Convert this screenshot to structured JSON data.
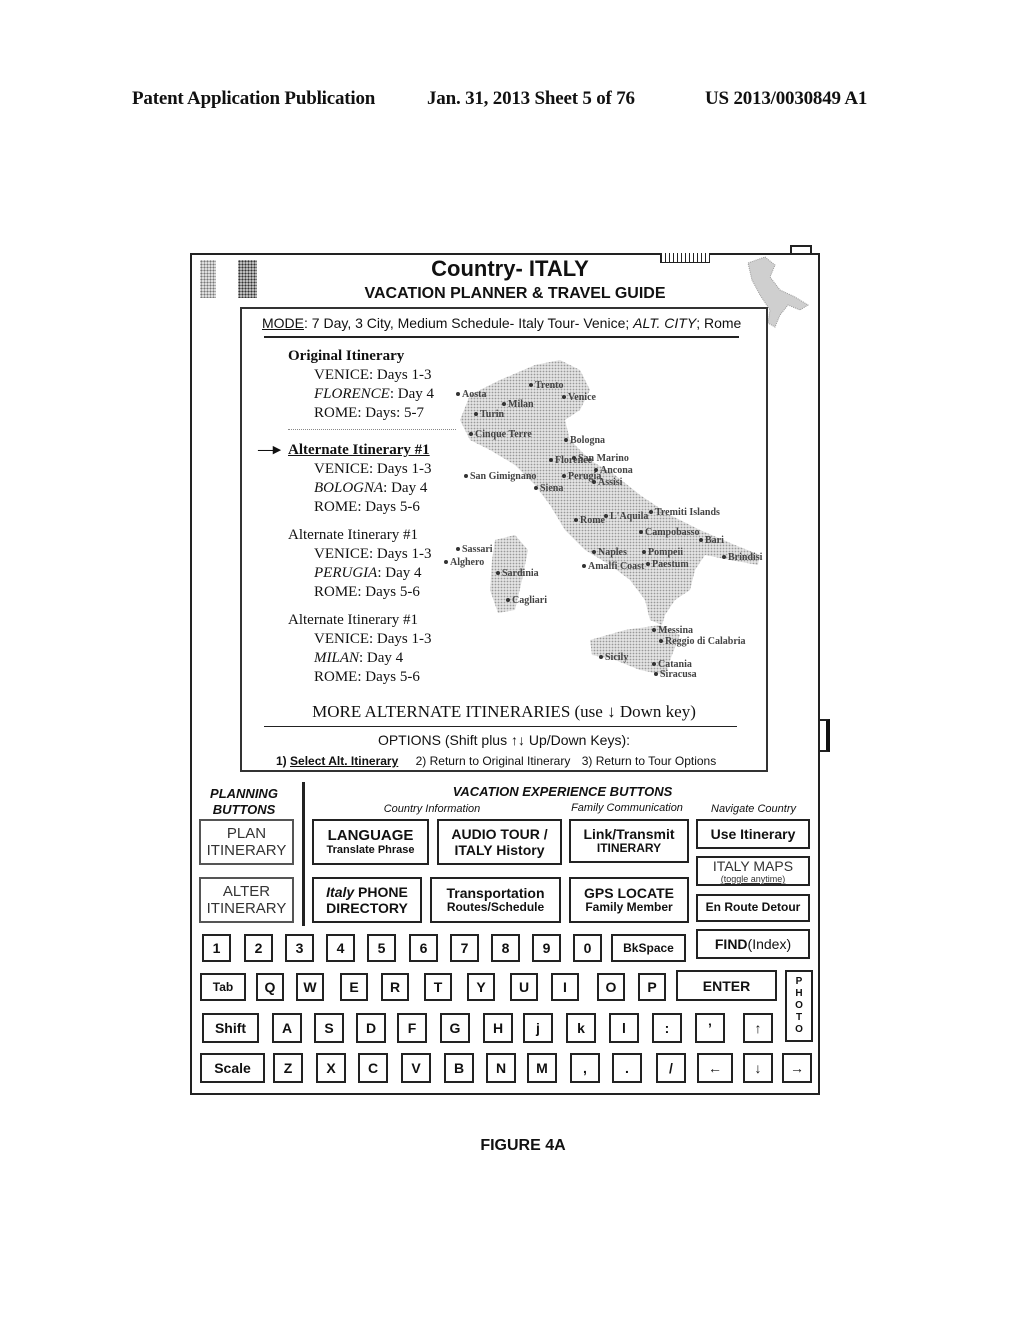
{
  "patent_header": {
    "publication": "Patent Application Publication",
    "date_sheet": "Jan. 31, 2013  Sheet 5 of 76",
    "number": "US 2013/0030849 A1"
  },
  "device": {
    "title": "Country- ITALY",
    "subtitle": "VACATION PLANNER & TRAVEL GUIDE"
  },
  "screen": {
    "mode_label": "MODE",
    "mode_text": ": 7 Day, 3 City, Medium Schedule- Italy Tour- Venice; ",
    "mode_alt": "ALT. CITY",
    "mode_end": "; Rome",
    "itineraries": [
      {
        "title": "Original Itinerary",
        "style": "bold",
        "cities": [
          {
            "name": "VENICE",
            "italic": false,
            "days": ": Days 1-3"
          },
          {
            "name": "FLORENCE",
            "italic": true,
            "days": ": Day 4"
          },
          {
            "name": "ROME",
            "italic": false,
            "days": ": Days: 5-7"
          }
        ]
      },
      {
        "title": "Alternate Itinerary #1",
        "style": "selected",
        "cities": [
          {
            "name": "VENICE",
            "italic": false,
            "days": ": Days 1-3"
          },
          {
            "name": "BOLOGNA",
            "italic": true,
            "days": ": Day 4"
          },
          {
            "name": "ROME",
            "italic": false,
            "days": ": Days 5-6"
          }
        ]
      },
      {
        "title": "Alternate Itinerary #1",
        "style": "normal",
        "cities": [
          {
            "name": "VENICE",
            "italic": false,
            "days": ": Days 1-3"
          },
          {
            "name": "PERUGIA",
            "italic": true,
            "days": ": Day 4"
          },
          {
            "name": "ROME",
            "italic": false,
            "days": ": Days 5-6"
          }
        ]
      },
      {
        "title": "Alternate Itinerary #1",
        "style": "normal",
        "cities": [
          {
            "name": "VENICE",
            "italic": false,
            "days": ": Days 1-3"
          },
          {
            "name": "MILAN",
            "italic": true,
            "days": ": Day 4"
          },
          {
            "name": "ROME",
            "italic": false,
            "days": ": Days 5-6"
          }
        ]
      }
    ],
    "selection_arrow": "—▸",
    "more": "MORE ALTERNATE ITINERARIES (use ↓ Down key)",
    "options_title": "OPTIONS (Shift plus ↑↓ Up/Down Keys):",
    "options": [
      {
        "num": "1) ",
        "label": "Select Alt. Itinerary"
      },
      {
        "num": "",
        "label": "2) Return to Original Itinerary"
      },
      {
        "num": "",
        "label": "3) Return to Tour Options"
      }
    ],
    "map_cities": [
      "Aosta",
      "Trento",
      "Milan",
      "Venice",
      "Turin",
      "Cinque Terre",
      "Bologna",
      "Florence",
      "San Marino",
      "San Gimignano",
      "Perugia",
      "Ancona",
      "Siena",
      "Assisi",
      "L'Aquila",
      "Tremiti Islands",
      "Rome",
      "Campobasso",
      "Bari",
      "Sassari",
      "Alghero",
      "Sardinia",
      "Naples",
      "Pompeii",
      "Brindisi",
      "Amalfi Coast",
      "Paestum",
      "Cagliari",
      "Messina",
      "Reggio di Calabria",
      "Sicily",
      "Catania",
      "Siracusa"
    ]
  },
  "planning": {
    "heading_1": "PLANNING",
    "heading_2": "BUTTONS",
    "plan_1": "PLAN",
    "plan_2": "ITINERARY",
    "alter_1": "ALTER",
    "alter_2": "ITINERARY"
  },
  "experience": {
    "heading": "VACATION EXPERIENCE BUTTONS",
    "col_country": "Country Information",
    "col_family": "Family Communication",
    "col_navigate": "Navigate Country",
    "language_1": "LANGUAGE",
    "language_2": "Translate Phrase",
    "audio_1": "AUDIO TOUR /",
    "audio_2": "ITALY History",
    "link_1": "Link/Transmit",
    "link_2": "ITINERARY",
    "use_itinerary": "Use Itinerary",
    "phone_italic": "Italy",
    "phone_1": " PHONE",
    "phone_2": "DIRECTORY",
    "transport_1": "Transportation",
    "transport_2": "Routes/Schedule",
    "gps_1": "GPS LOCATE",
    "gps_2": "Family Member",
    "maps_1": "ITALY MAPS",
    "maps_2": "(toggle anytime)",
    "detour": "En Route Detour"
  },
  "keyboard": {
    "row1": [
      "1",
      "2",
      "3",
      "4",
      "5",
      "6",
      "7",
      "8",
      "9",
      "0"
    ],
    "bkspace": "BkSpace",
    "find_bold": "FIND",
    "find_rest": " (Index)",
    "tab": "Tab",
    "row2": [
      "Q",
      "W",
      "E",
      "R",
      "T",
      "Y",
      "U",
      "I",
      "O",
      "P"
    ],
    "enter": "ENTER",
    "photo": [
      "P",
      "H",
      "O",
      "T",
      "O"
    ],
    "shift": "Shift",
    "row3": [
      "A",
      "S",
      "D",
      "F",
      "G",
      "H",
      "j",
      "k",
      "l",
      ":",
      "’",
      "↑"
    ],
    "scale": "Scale",
    "row4": [
      "Z",
      "X",
      "C",
      "V",
      "B",
      "N",
      "M",
      ",",
      ".",
      "/",
      "←",
      "↓",
      "→"
    ]
  },
  "figure_caption": "FIGURE 4A"
}
